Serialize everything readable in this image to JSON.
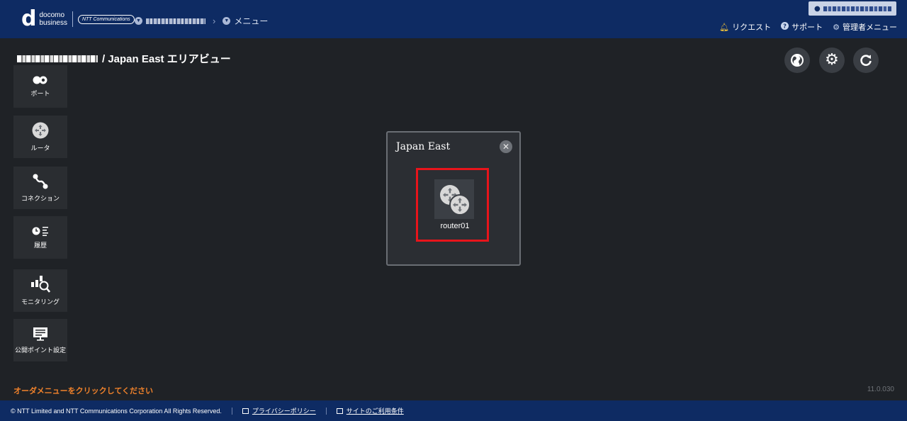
{
  "header": {
    "logo_d": "d",
    "logo_line1": "docomo",
    "logo_line2": "business",
    "ntt_logo": "NTT Communications",
    "breadcrumb_current": "メニュー",
    "links": {
      "request": "リクエスト",
      "support": "サポート",
      "admin_menu": "管理者メニュー"
    }
  },
  "page": {
    "title": "/ Japan East エリアビュー"
  },
  "sidebar": {
    "items": [
      {
        "label": "ポート",
        "icon": "port-icon"
      },
      {
        "label": "ルータ",
        "icon": "router-icon"
      },
      {
        "label": "コネクション",
        "icon": "connection-icon"
      },
      {
        "label": "履歴",
        "icon": "history-icon"
      },
      {
        "label": "モニタリング",
        "icon": "monitoring-icon"
      },
      {
        "label": "公開ポイント設定",
        "icon": "public-point-icon"
      }
    ]
  },
  "toolbar": {
    "buttons": [
      "globe-icon",
      "gear-icon",
      "refresh-icon"
    ]
  },
  "area_panel": {
    "title": "Japan East",
    "close": "✕",
    "router_name": "router01"
  },
  "order_hint": "オーダメニューをクリックしてください",
  "version": "11.0.030",
  "footer": {
    "copyright": "© NTT Limited and NTT Communications Corporation All Rights Reserved.",
    "privacy": "プライバシーポリシー",
    "terms": "サイトのご利用条件"
  },
  "colors": {
    "header_bg": "#0e2b63",
    "page_bg": "#1f2226",
    "highlight": "#e8141b",
    "hint": "#f0822b"
  }
}
